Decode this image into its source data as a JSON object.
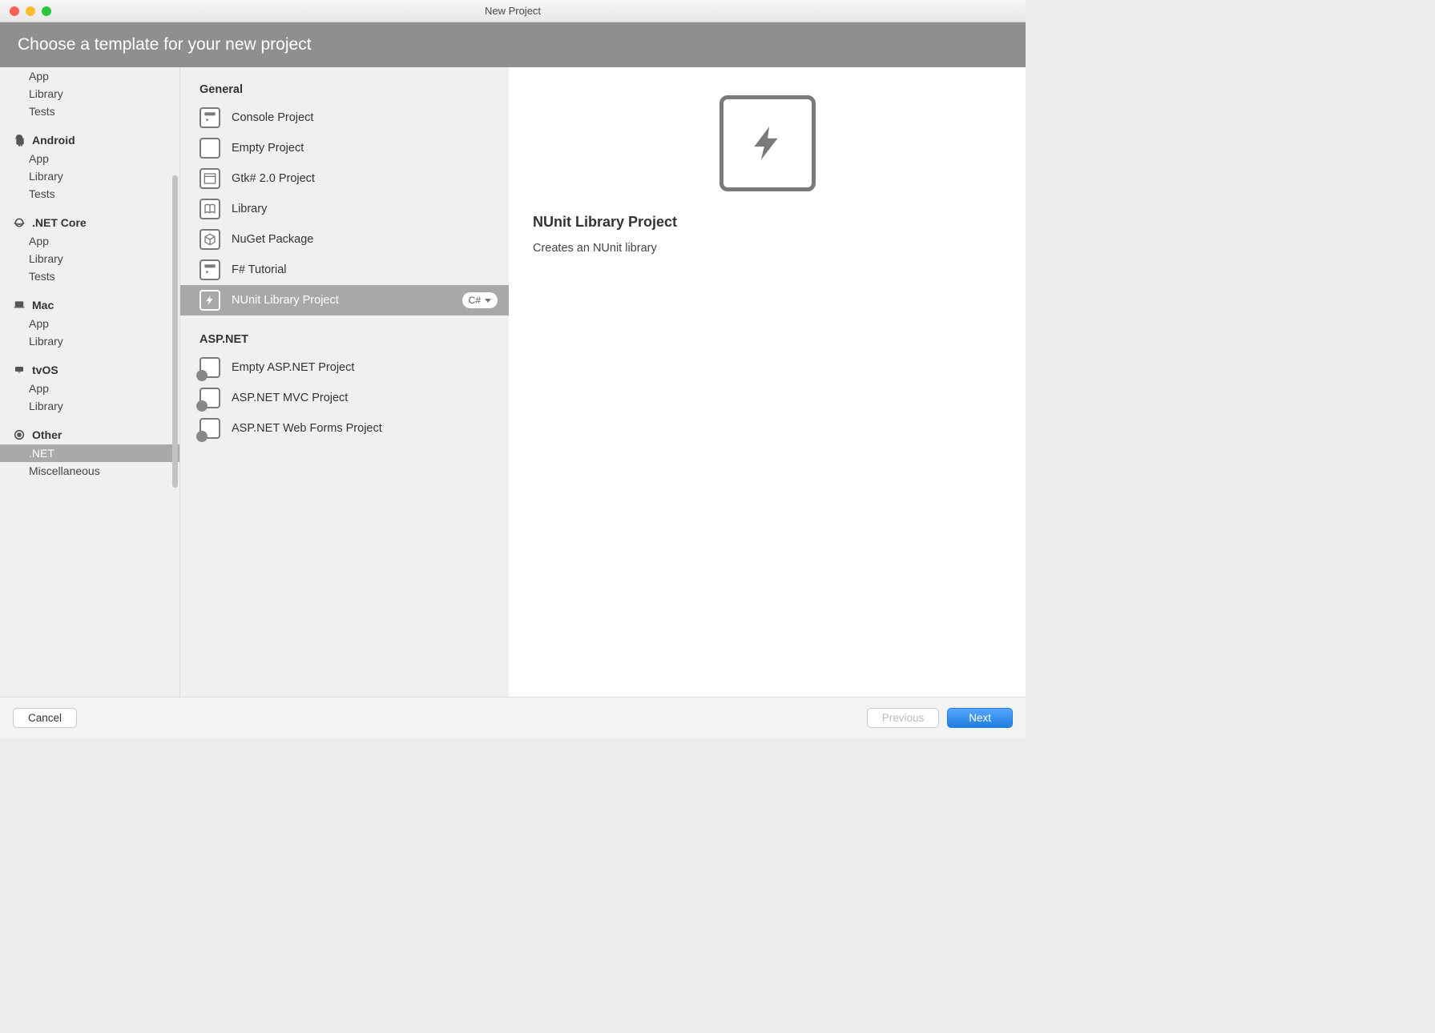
{
  "window": {
    "title": "New Project"
  },
  "header": {
    "title": "Choose a template for your new project"
  },
  "sidebar": {
    "categories": [
      {
        "name": "",
        "icon": "",
        "items": [
          "App",
          "Library",
          "Tests"
        ]
      },
      {
        "name": "Android",
        "icon": "android",
        "items": [
          "App",
          "Library",
          "Tests"
        ]
      },
      {
        "name": ".NET Core",
        "icon": "dotnetcore",
        "items": [
          "App",
          "Library",
          "Tests"
        ]
      },
      {
        "name": "Mac",
        "icon": "mac",
        "items": [
          "App",
          "Library"
        ]
      },
      {
        "name": "tvOS",
        "icon": "tvos",
        "items": [
          "App",
          "Library"
        ]
      },
      {
        "name": "Other",
        "icon": "other",
        "items": [
          ".NET",
          "Miscellaneous"
        ],
        "selected": ".NET"
      }
    ]
  },
  "templates": {
    "groups": [
      {
        "name": "General",
        "items": [
          {
            "label": "Console Project",
            "icon": "terminal"
          },
          {
            "label": "Empty Project",
            "icon": "empty"
          },
          {
            "label": "Gtk# 2.0 Project",
            "icon": "window"
          },
          {
            "label": "Library",
            "icon": "book"
          },
          {
            "label": "NuGet Package",
            "icon": "cube"
          },
          {
            "label": "F# Tutorial",
            "icon": "terminal"
          },
          {
            "label": "NUnit Library Project",
            "icon": "bolt",
            "selected": true,
            "lang": "C#"
          }
        ]
      },
      {
        "name": "ASP.NET",
        "items": [
          {
            "label": "Empty ASP.NET Project",
            "icon": "aspnet"
          },
          {
            "label": "ASP.NET MVC Project",
            "icon": "aspnet"
          },
          {
            "label": "ASP.NET Web Forms Project",
            "icon": "aspnet"
          }
        ]
      }
    ]
  },
  "details": {
    "title": "NUnit Library Project",
    "description": "Creates an NUnit library"
  },
  "footer": {
    "cancel": "Cancel",
    "previous": "Previous",
    "next": "Next"
  }
}
